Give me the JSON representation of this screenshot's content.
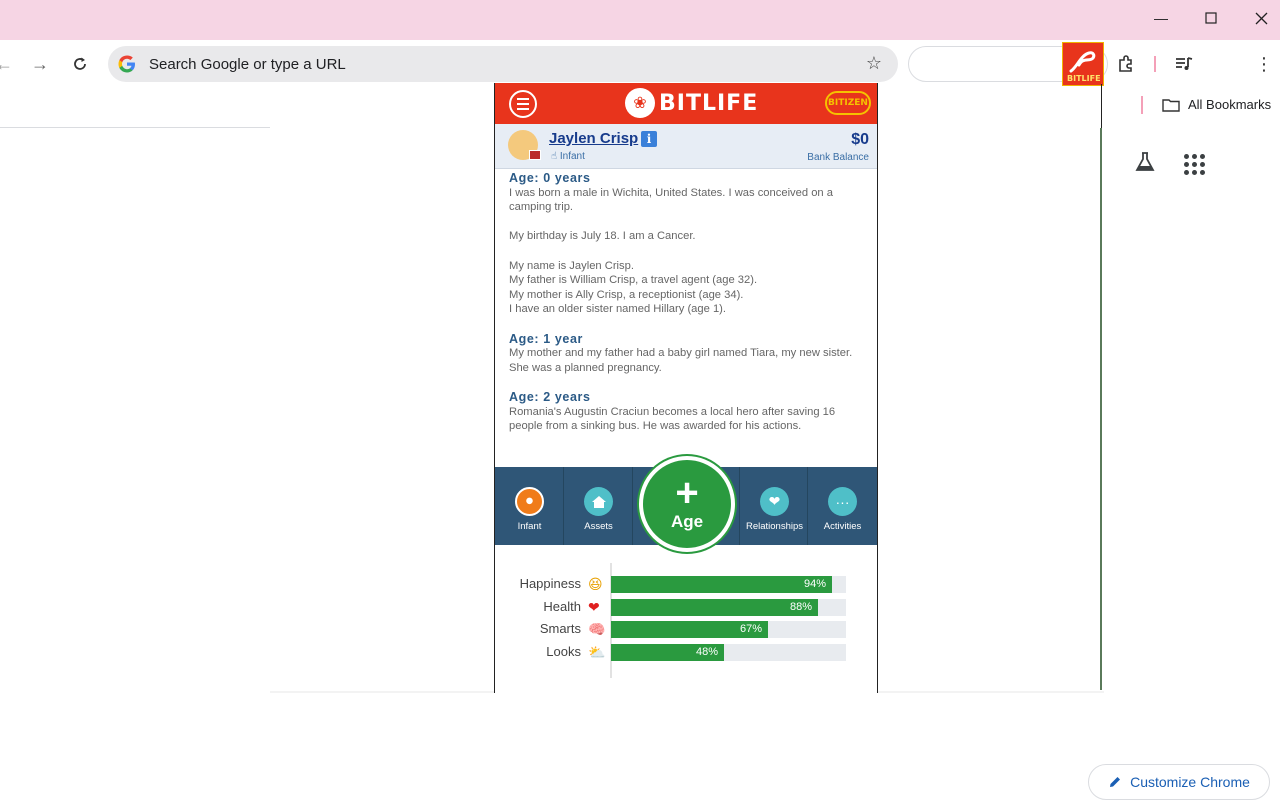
{
  "browser": {
    "omnibox_placeholder": "Search Google or type a URL",
    "bookmarks_label": "All Bookmarks",
    "customize_label": "Customize Chrome",
    "extension_label": "BITLIFE"
  },
  "game": {
    "logo_text": "BITLIFE",
    "bitizen_label": "BITIZEN",
    "character": {
      "name": "Jaylen Crisp",
      "stage": "Infant",
      "money": "$0",
      "money_label": "Bank Balance"
    },
    "log": [
      {
        "heading": "Age: 0 years",
        "paragraphs": [
          "I was born a male in Wichita, United States. I was conceived on a camping trip.",
          "My birthday is July 18. I am a Cancer.",
          "My name is Jaylen Crisp.\nMy father is William Crisp, a travel agent (age 32).\nMy mother is Ally Crisp, a receptionist (age 34).\nI have an older sister named Hillary (age 1)."
        ]
      },
      {
        "heading": "Age: 1 year",
        "paragraphs": [
          "My mother and my father had a baby girl named Tiara, my new sister. She was a planned pregnancy."
        ]
      },
      {
        "heading": "Age: 2 years",
        "paragraphs": [
          "Romania's Augustin Craciun becomes a local hero after saving 16 people from a sinking bus. He was awarded for his actions."
        ]
      }
    ],
    "nav": {
      "infant": "Infant",
      "assets": "Assets",
      "age": "Age",
      "relationships": "Relationships",
      "activities": "Activities"
    },
    "colors": {
      "header_red": "#e8341c",
      "nav_blue": "#2f5677",
      "stat_green": "#2a9a3f",
      "infant_orange": "#f07c1a",
      "teal": "#4fbfc8"
    },
    "stats": [
      {
        "label": "Happiness",
        "emoji": "😆",
        "value": 94,
        "text": "94%"
      },
      {
        "label": "Health",
        "emoji": "❤",
        "value": 88,
        "text": "88%"
      },
      {
        "label": "Smarts",
        "emoji": "🧠",
        "value": 67,
        "text": "67%"
      },
      {
        "label": "Looks",
        "emoji": "⛅",
        "value": 48,
        "text": "48%"
      }
    ]
  }
}
